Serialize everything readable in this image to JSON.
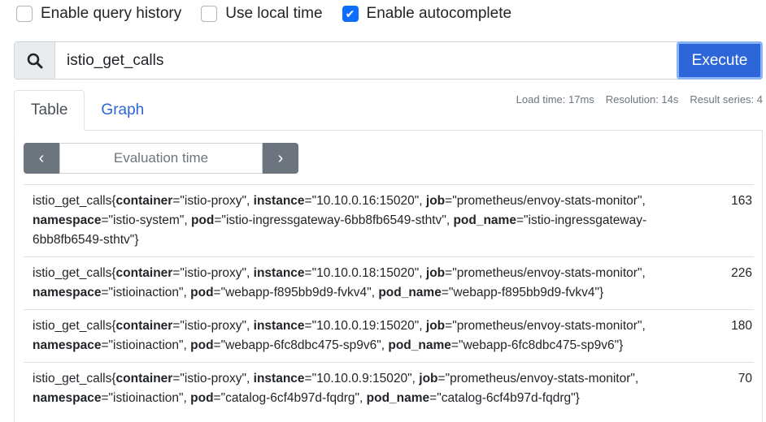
{
  "options": [
    {
      "label": "Enable query history",
      "checked": false
    },
    {
      "label": "Use local time",
      "checked": false
    },
    {
      "label": "Enable autocomplete",
      "checked": true
    }
  ],
  "search": {
    "value": "istio_get_calls",
    "execute_label": "Execute"
  },
  "tabs": [
    {
      "label": "Table"
    },
    {
      "label": "Graph"
    }
  ],
  "stats": {
    "load_time": "Load time: 17ms",
    "resolution": "Resolution: 14s",
    "result_series": "Result series: 4"
  },
  "eval": {
    "placeholder": "Evaluation time",
    "prev": "‹",
    "next": "›"
  },
  "results": [
    {
      "metric": "istio_get_calls",
      "labels": [
        [
          "container",
          "istio-proxy"
        ],
        [
          "instance",
          "10.10.0.16:15020"
        ],
        [
          "job",
          "prometheus/envoy-stats-monitor"
        ],
        [
          "namespace",
          "istio-system"
        ],
        [
          "pod",
          "istio-ingressgateway-6bb8fb6549-sthtv"
        ],
        [
          "pod_name",
          "istio-ingressgateway-6bb8fb6549-sthtv"
        ]
      ],
      "value": "163"
    },
    {
      "metric": "istio_get_calls",
      "labels": [
        [
          "container",
          "istio-proxy"
        ],
        [
          "instance",
          "10.10.0.18:15020"
        ],
        [
          "job",
          "prometheus/envoy-stats-monitor"
        ],
        [
          "namespace",
          "istioinaction"
        ],
        [
          "pod",
          "webapp-f895bb9d9-fvkv4"
        ],
        [
          "pod_name",
          "webapp-f895bb9d9-fvkv4"
        ]
      ],
      "value": "226"
    },
    {
      "metric": "istio_get_calls",
      "labels": [
        [
          "container",
          "istio-proxy"
        ],
        [
          "instance",
          "10.10.0.19:15020"
        ],
        [
          "job",
          "prometheus/envoy-stats-monitor"
        ],
        [
          "namespace",
          "istioinaction"
        ],
        [
          "pod",
          "webapp-6fc8dbc475-sp9v6"
        ],
        [
          "pod_name",
          "webapp-6fc8dbc475-sp9v6"
        ]
      ],
      "value": "180"
    },
    {
      "metric": "istio_get_calls",
      "labels": [
        [
          "container",
          "istio-proxy"
        ],
        [
          "instance",
          "10.10.0.9:15020"
        ],
        [
          "job",
          "prometheus/envoy-stats-monitor"
        ],
        [
          "namespace",
          "istioinaction"
        ],
        [
          "pod",
          "catalog-6cf4b97d-fqdrg"
        ],
        [
          "pod_name",
          "catalog-6cf4b97d-fqdrg"
        ]
      ],
      "value": "70"
    }
  ]
}
